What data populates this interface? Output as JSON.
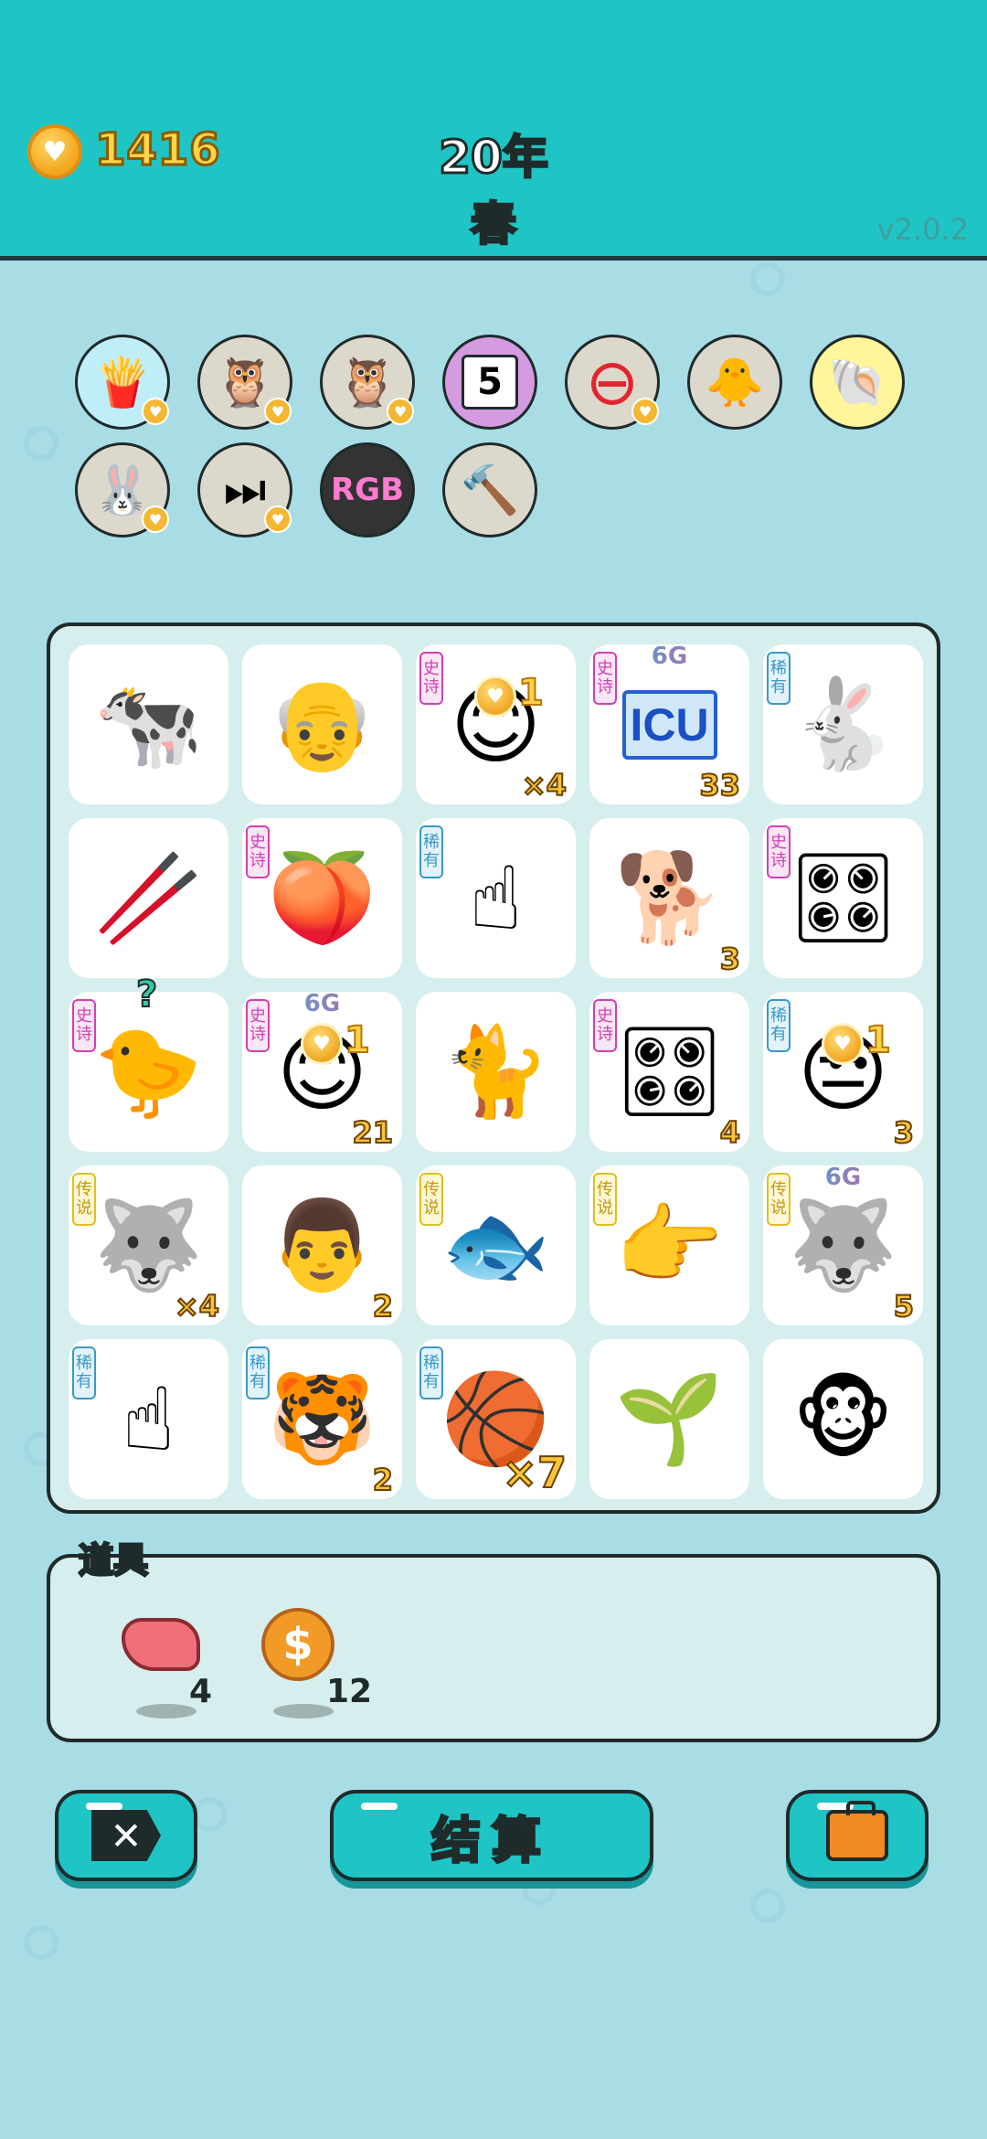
{
  "header": {
    "coins": "1416",
    "year_label": "20年",
    "season_label": "春",
    "version": "v2.0.2"
  },
  "relics": [
    {
      "name": "fries-icon",
      "glyph": "🍟",
      "bg": "#bfeef8",
      "coin": true
    },
    {
      "name": "owl-pair-icon",
      "glyph": "🦉",
      "bg": "#ddd8cc",
      "coin": true
    },
    {
      "name": "owl-pair-icon-2",
      "glyph": "🦉",
      "bg": "#ddd8cc",
      "coin": true
    },
    {
      "name": "calendar-icon",
      "glyph": "5",
      "bg": "#d49be0",
      "coin": false
    },
    {
      "name": "minus-icon",
      "glyph": "⊖",
      "bg": "#ddd8cc",
      "coin": true
    },
    {
      "name": "chick-egg-icon",
      "glyph": "🐥",
      "bg": "#ddd8cc",
      "coin": false
    },
    {
      "name": "shell-icon",
      "glyph": "🐚",
      "bg": "#fff59a",
      "coin": false
    },
    {
      "name": "rabbit-icon",
      "glyph": "🐰",
      "bg": "#ddd8cc",
      "coin": true
    },
    {
      "name": "skip-icon",
      "glyph": "⏭",
      "bg": "#ddd8cc",
      "coin": true
    },
    {
      "name": "rgb-icon",
      "glyph": "RGB",
      "bg": "#333333",
      "coin": false
    },
    {
      "name": "hammer-icon",
      "glyph": "🔨",
      "bg": "#ddd8cc",
      "coin": false
    }
  ],
  "board": [
    [
      {
        "name": "cow",
        "glyph": "🐄"
      },
      {
        "name": "old-man",
        "glyph": "👴"
      },
      {
        "name": "yellow-face",
        "glyph": "😊",
        "rarity": "史诗",
        "rarity_class": "r-epic",
        "coin": "1",
        "mult": "×4"
      },
      {
        "name": "icu",
        "glyph": "ICU",
        "rarity": "史诗",
        "rarity_class": "r-epic",
        "tag": "6G",
        "count": "33"
      },
      {
        "name": "rabbit-red",
        "glyph": "🐇",
        "rarity": "稀有",
        "rarity_class": "r-rare"
      }
    ],
    [
      {
        "name": "straw",
        "glyph": "🥢"
      },
      {
        "name": "peach",
        "glyph": "🍑",
        "rarity": "史诗",
        "rarity_class": "r-epic"
      },
      {
        "name": "pointing-finger",
        "glyph": "☝",
        "rarity": "稀有",
        "rarity_class": "r-rare"
      },
      {
        "name": "husky",
        "glyph": "🐕",
        "count": "3"
      },
      {
        "name": "gpu",
        "glyph": "🎛",
        "rarity": "史诗",
        "rarity_class": "r-epic"
      }
    ],
    [
      {
        "name": "grey-hair-chick",
        "glyph": "🐤",
        "rarity": "史诗",
        "rarity_class": "r-epic",
        "question": "?"
      },
      {
        "name": "yellow-face-2",
        "glyph": "😊",
        "rarity": "史诗",
        "rarity_class": "r-epic",
        "tag": "6G",
        "coin": "1",
        "count": "21"
      },
      {
        "name": "cat",
        "glyph": "🐈"
      },
      {
        "name": "gpu-2",
        "glyph": "🎛",
        "rarity": "史诗",
        "rarity_class": "r-epic",
        "count": "4"
      },
      {
        "name": "grumpy-man",
        "glyph": "😒",
        "rarity": "稀有",
        "rarity_class": "r-rare",
        "coin": "1",
        "count": "3"
      }
    ],
    [
      {
        "name": "husky-king",
        "glyph": "🐺",
        "rarity": "传说",
        "rarity_class": "r-leg",
        "mult": "×4"
      },
      {
        "name": "man-face",
        "glyph": "👨",
        "count": "2"
      },
      {
        "name": "koi-fish",
        "glyph": "🐟",
        "rarity": "传说",
        "rarity_class": "r-leg"
      },
      {
        "name": "golden-finger",
        "glyph": "👉",
        "rarity": "传说",
        "rarity_class": "r-leg"
      },
      {
        "name": "husky-king-2",
        "glyph": "🐺",
        "rarity": "传说",
        "rarity_class": "r-leg",
        "tag": "6G",
        "count": "5"
      }
    ],
    [
      {
        "name": "pointing-finger-2",
        "glyph": "☝",
        "rarity": "稀有",
        "rarity_class": "r-rare"
      },
      {
        "name": "tiger",
        "glyph": "🐯",
        "rarity": "稀有",
        "rarity_class": "r-rare",
        "count": "2"
      },
      {
        "name": "basketball-man",
        "glyph": "🏀",
        "rarity": "稀有",
        "rarity_class": "r-rare",
        "mult": "×7",
        "big": true
      },
      {
        "name": "sprout",
        "glyph": "🌱"
      },
      {
        "name": "monkey-elder",
        "glyph": "🐵"
      }
    ]
  ],
  "items": {
    "title": "道具",
    "list": [
      {
        "name": "liver-item",
        "qty": "4"
      },
      {
        "name": "dollar-coin-item",
        "qty": "12"
      }
    ]
  },
  "buttons": {
    "close_label": "✕",
    "settle_label": "结算"
  },
  "colors": {
    "header": "#1fc4c4",
    "background": "#a9dde6",
    "coin_text": "#ffd34a",
    "season_text": "#27e05a"
  }
}
